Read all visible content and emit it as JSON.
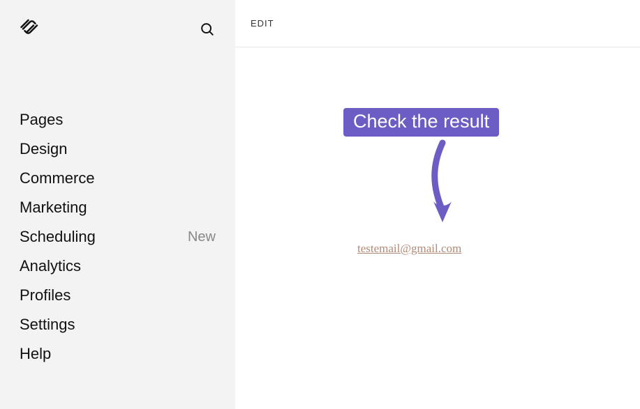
{
  "topbar": {
    "edit_label": "EDIT"
  },
  "sidebar": {
    "items": [
      {
        "label": "Pages",
        "badge": null
      },
      {
        "label": "Design",
        "badge": null
      },
      {
        "label": "Commerce",
        "badge": null
      },
      {
        "label": "Marketing",
        "badge": null
      },
      {
        "label": "Scheduling",
        "badge": "New"
      },
      {
        "label": "Analytics",
        "badge": null
      },
      {
        "label": "Profiles",
        "badge": null
      },
      {
        "label": "Settings",
        "badge": null
      },
      {
        "label": "Help",
        "badge": null
      }
    ]
  },
  "annotation": {
    "callout_text": "Check the result",
    "callout_color": "#6B5DC4"
  },
  "content": {
    "email_text": "testemail@gmail.com",
    "email_color": "#b08a77"
  }
}
